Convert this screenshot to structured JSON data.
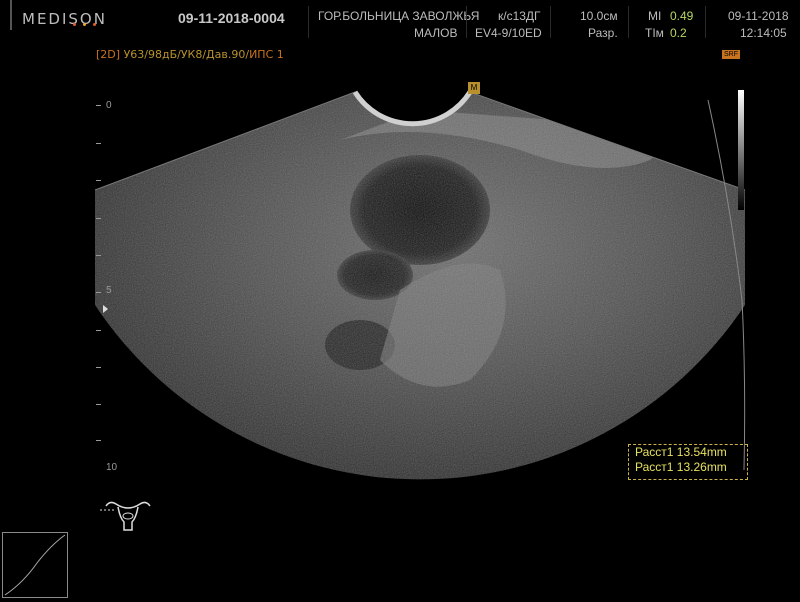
{
  "header": {
    "brand": "MEDISON",
    "dot_colors": [
      "#e05a2a",
      "#f0a030",
      "#e05a2a"
    ],
    "patient_id": "09-11-2018-0004",
    "institution": "ГОР.БОЛЬНИЦА ЗАВОЛЖЬЯ",
    "operator": "МАЛОВ",
    "preset": "к/с13ДГ",
    "probe": "EV4-9/10ED",
    "depth": "10.0см",
    "resolution": "Разр.",
    "mi_label": "MI",
    "mi_value": "0.49",
    "tim_label": "TIм",
    "tim_value": "0.2",
    "date": "09-11-2018",
    "time": "12:14:05"
  },
  "mode": {
    "mode_2d": "[2D]",
    "params": "У63/98дБ/УК8/Дав.90/",
    "ips": "ИПС 1"
  },
  "srf_label": "SRF",
  "focus_label": "M",
  "ruler": {
    "label_0": "0",
    "label_5": "5",
    "label_10": "10"
  },
  "measurements": {
    "m1": "Расст1 13.54mm",
    "m2": "Расст1 13.26mm"
  },
  "icons": {
    "uterus": "uterus-icon",
    "curve": "gamma-curve-icon"
  }
}
